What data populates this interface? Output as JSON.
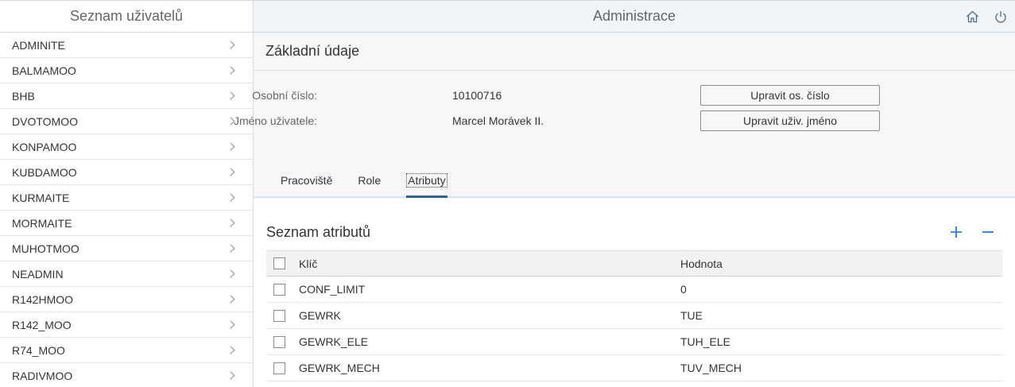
{
  "master": {
    "title": "Seznam uživatelů",
    "users": [
      "ADMINITE",
      "BALMAMOO",
      "BHB",
      "DVOTOMOO",
      "KONPAMOO",
      "KUBDAMOO",
      "KURMAITE",
      "MORMAITE",
      "MUHOTMOO",
      "NEADMIN",
      "R142HMOO",
      "R142_MOO",
      "R74_MOO",
      "RADIVMOO"
    ]
  },
  "header": {
    "title": "Administrace",
    "icons": [
      "home-icon",
      "power-icon"
    ]
  },
  "basic": {
    "title": "Základní údaje",
    "personal_number_label": "Osobní číslo:",
    "personal_number_value": "10100716",
    "edit_number_button": "Upravit os. číslo",
    "username_label": "Jméno uživatele:",
    "username_value": "Marcel Morávek II.",
    "edit_name_button": "Upravit uživ. jméno"
  },
  "tabs": [
    {
      "label": "Pracoviště"
    },
    {
      "label": "Role"
    },
    {
      "label": "Atributy"
    }
  ],
  "active_tab": "Atributy",
  "attributes": {
    "title": "Seznam atributů",
    "add_icon": "plus-icon",
    "remove_icon": "minus-icon",
    "columns": [
      "Klíč",
      "Hodnota"
    ],
    "rows": [
      {
        "key": "CONF_LIMIT",
        "value": "0"
      },
      {
        "key": "GEWRK",
        "value": "TUE"
      },
      {
        "key": "GEWRK_ELE",
        "value": "TUH_ELE"
      },
      {
        "key": "GEWRK_MECH",
        "value": "TUV_MECH"
      }
    ]
  },
  "colors": {
    "accent": "#0a6ed1",
    "tab_indicator": "#346187"
  }
}
